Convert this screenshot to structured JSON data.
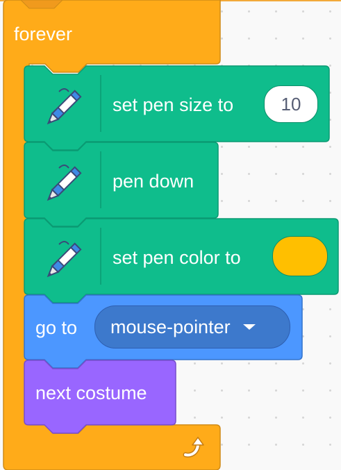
{
  "loop_block": {
    "label": "forever",
    "loop_icon": "loop-arrow-icon",
    "color": "#ffab19"
  },
  "blocks": [
    {
      "label": "set pen size to",
      "value": "10",
      "icon": "pen-icon",
      "color": "#0fbd8c"
    },
    {
      "label": "pen down",
      "icon": "pen-icon",
      "color": "#0fbd8c"
    },
    {
      "label": "set pen color to",
      "swatch_color": "#ffbf00",
      "icon": "pen-icon",
      "color": "#0fbd8c"
    },
    {
      "label": "go to",
      "dropdown_value": "mouse-pointer",
      "color": "#4c97ff"
    },
    {
      "label": "next costume",
      "color": "#9966ff"
    }
  ]
}
